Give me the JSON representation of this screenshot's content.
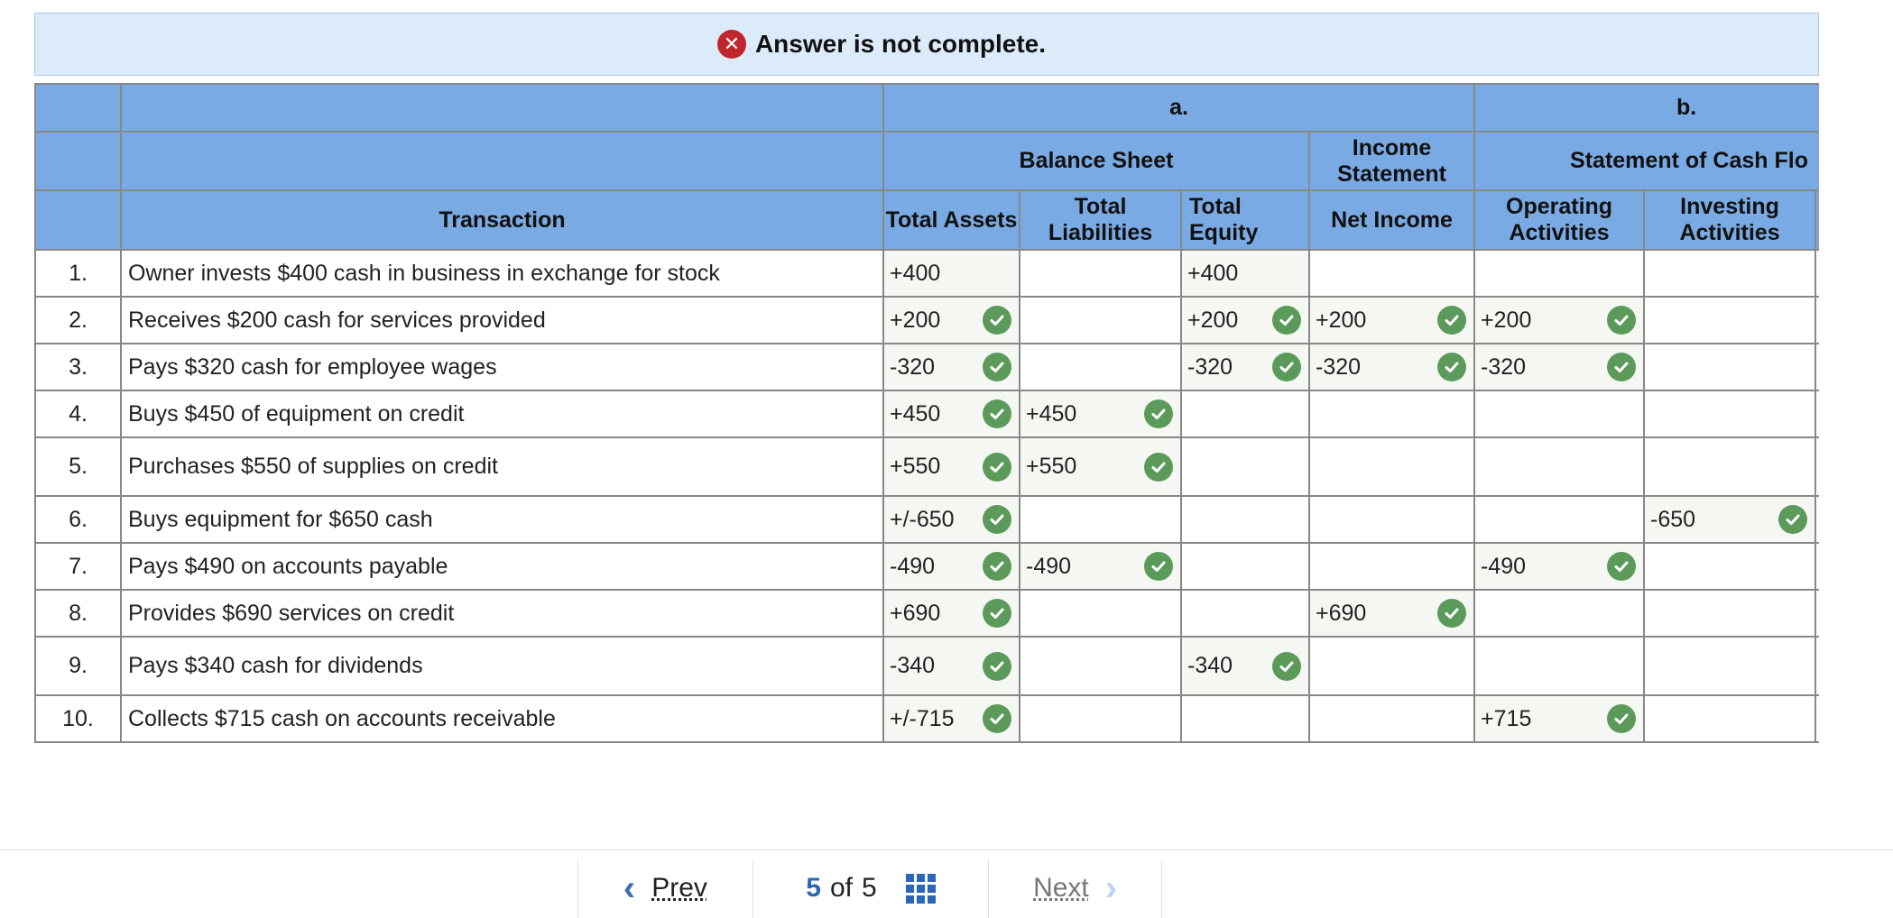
{
  "banner": {
    "icon": "x-circle-icon",
    "text": "Answer is not complete."
  },
  "headers": {
    "a": "a.",
    "b": "b.",
    "balance_sheet": "Balance Sheet",
    "income_statement": "Income Statement",
    "cash_flows": "Statement of Cash Flo",
    "transaction": "Transaction",
    "total_assets": "Total Assets",
    "total_liabilities": "Total Liabilities",
    "total_equity": "Total Equity",
    "net_income": "Net Income",
    "operating": "Operating Activities",
    "investing": "Investing Activities"
  },
  "rows": [
    {
      "num": "1.",
      "desc": "Owner invests $400 cash in business in exchange for stock",
      "assets": {
        "v": "+400",
        "ok": false
      },
      "liabilities": {
        "v": "",
        "ok": false
      },
      "equity": {
        "v": "+400",
        "ok": false
      },
      "net_income": {
        "v": "",
        "ok": false
      },
      "operating": {
        "v": "",
        "ok": false
      },
      "investing": {
        "v": "",
        "ok": false
      }
    },
    {
      "num": "2.",
      "desc": "Receives $200 cash for services provided",
      "assets": {
        "v": "+200",
        "ok": true
      },
      "liabilities": {
        "v": "",
        "ok": false
      },
      "equity": {
        "v": "+200",
        "ok": true
      },
      "net_income": {
        "v": "+200",
        "ok": true
      },
      "operating": {
        "v": "+200",
        "ok": true
      },
      "investing": {
        "v": "",
        "ok": false
      }
    },
    {
      "num": "3.",
      "desc": "Pays $320 cash for employee wages",
      "assets": {
        "v": "-320",
        "ok": true
      },
      "liabilities": {
        "v": "",
        "ok": false
      },
      "equity": {
        "v": "-320",
        "ok": true
      },
      "net_income": {
        "v": "-320",
        "ok": true
      },
      "operating": {
        "v": "-320",
        "ok": true
      },
      "investing": {
        "v": "",
        "ok": false
      }
    },
    {
      "num": "4.",
      "desc": "Buys $450 of equipment on credit",
      "assets": {
        "v": "+450",
        "ok": true
      },
      "liabilities": {
        "v": "+450",
        "ok": true
      },
      "equity": {
        "v": "",
        "ok": false
      },
      "net_income": {
        "v": "",
        "ok": false
      },
      "operating": {
        "v": "",
        "ok": false
      },
      "investing": {
        "v": "",
        "ok": false
      }
    },
    {
      "num": "5.",
      "desc": "Purchases $550 of supplies on credit",
      "assets": {
        "v": "+550",
        "ok": true
      },
      "liabilities": {
        "v": "+550",
        "ok": true
      },
      "equity": {
        "v": "",
        "ok": false
      },
      "net_income": {
        "v": "",
        "ok": false
      },
      "operating": {
        "v": "",
        "ok": false
      },
      "investing": {
        "v": "",
        "ok": false
      }
    },
    {
      "num": "6.",
      "desc": "Buys equipment for $650 cash",
      "assets": {
        "v": "+/-650",
        "ok": true
      },
      "liabilities": {
        "v": "",
        "ok": false
      },
      "equity": {
        "v": "",
        "ok": false
      },
      "net_income": {
        "v": "",
        "ok": false
      },
      "operating": {
        "v": "",
        "ok": false
      },
      "investing": {
        "v": "-650",
        "ok": true
      }
    },
    {
      "num": "7.",
      "desc": "Pays $490 on accounts payable",
      "assets": {
        "v": "-490",
        "ok": true
      },
      "liabilities": {
        "v": "-490",
        "ok": true
      },
      "equity": {
        "v": "",
        "ok": false
      },
      "net_income": {
        "v": "",
        "ok": false
      },
      "operating": {
        "v": "-490",
        "ok": true
      },
      "investing": {
        "v": "",
        "ok": false
      }
    },
    {
      "num": "8.",
      "desc": "Provides $690 services on credit",
      "assets": {
        "v": "+690",
        "ok": true
      },
      "liabilities": {
        "v": "",
        "ok": false
      },
      "equity": {
        "v": "",
        "ok": false
      },
      "net_income": {
        "v": "+690",
        "ok": true
      },
      "operating": {
        "v": "",
        "ok": false
      },
      "investing": {
        "v": "",
        "ok": false
      }
    },
    {
      "num": "9.",
      "desc": "Pays $340 cash for dividends",
      "assets": {
        "v": "-340",
        "ok": true
      },
      "liabilities": {
        "v": "",
        "ok": false
      },
      "equity": {
        "v": "-340",
        "ok": true
      },
      "net_income": {
        "v": "",
        "ok": false
      },
      "operating": {
        "v": "",
        "ok": false
      },
      "investing": {
        "v": "",
        "ok": false
      }
    },
    {
      "num": "10.",
      "desc": "Collects $715 cash on accounts receivable",
      "assets": {
        "v": "+/-715",
        "ok": true
      },
      "liabilities": {
        "v": "",
        "ok": false
      },
      "equity": {
        "v": "",
        "ok": false
      },
      "net_income": {
        "v": "",
        "ok": false
      },
      "operating": {
        "v": "+715",
        "ok": true
      },
      "investing": {
        "v": "",
        "ok": false
      }
    }
  ],
  "pager": {
    "prev_label": "Prev",
    "next_label": "Next",
    "current": "5",
    "of_label": "of",
    "total": "5",
    "grid_icon": "grid-icon"
  },
  "colors": {
    "header_bg": "#7aaae4",
    "banner_bg": "#dcebf9",
    "error_red": "#c0262d",
    "check_green": "#5c9a5c",
    "link_blue": "#2b66b8"
  }
}
